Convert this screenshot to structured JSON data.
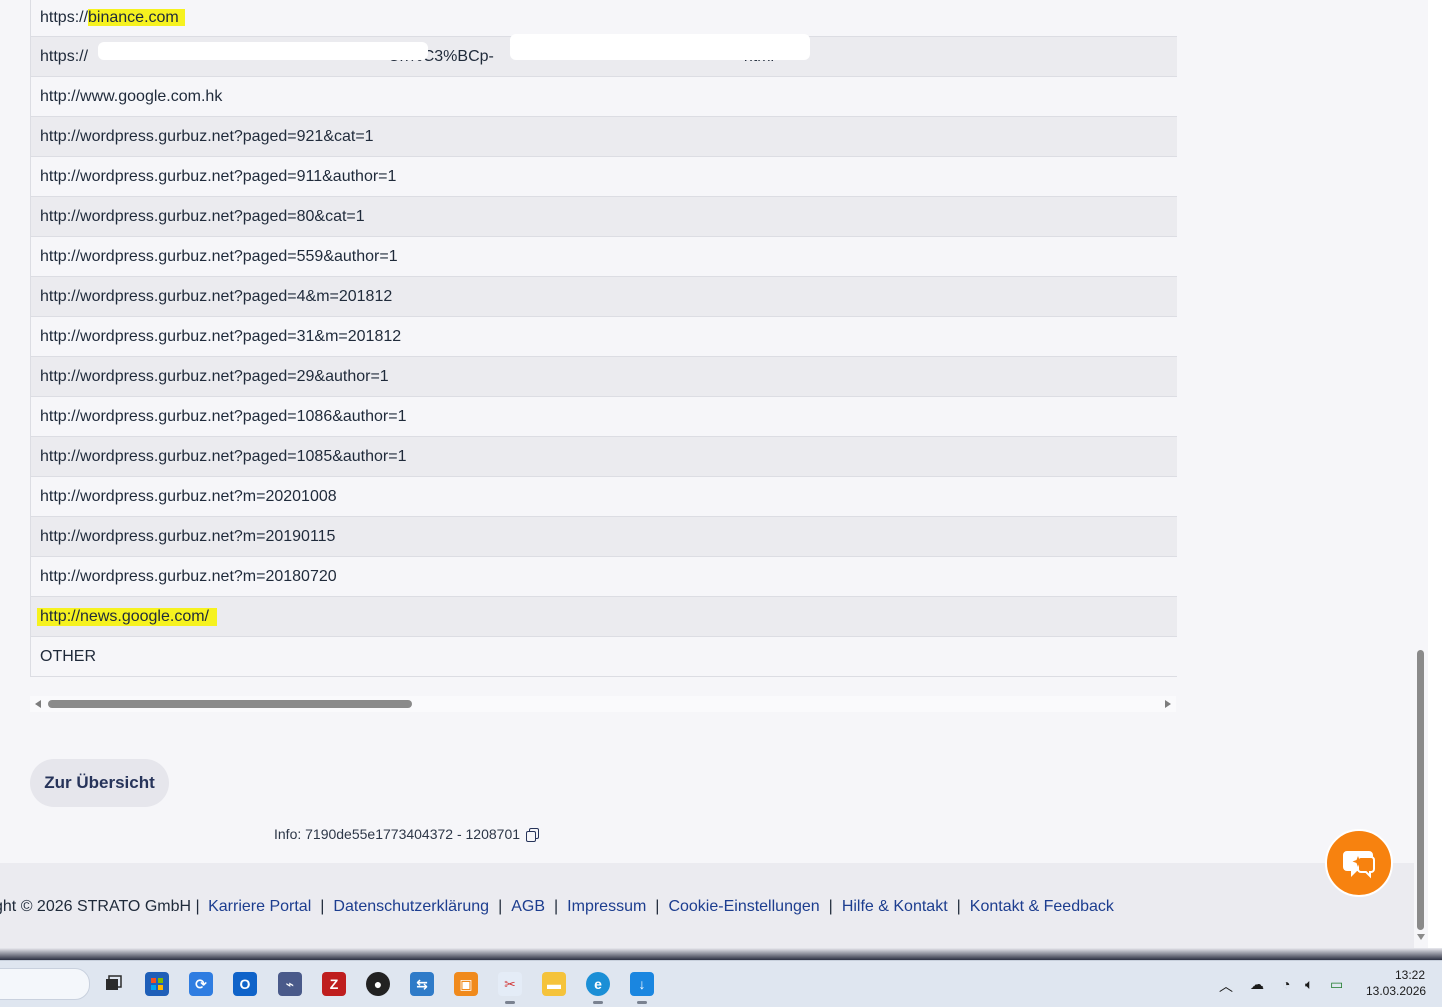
{
  "referrers": [
    {
      "url_prefix": "https://",
      "url_highlight": "binance.com",
      "url_suffix": "",
      "highlight": true
    },
    {
      "url_visible_start": "https://",
      "url_visible_mid": "Cn%C3%BCp-",
      "url_visible_end": "html",
      "redacted": true
    },
    {
      "url": "http://www.google.com.hk"
    },
    {
      "url": "http://wordpress.gurbuz.net?paged=921&cat=1"
    },
    {
      "url": "http://wordpress.gurbuz.net?paged=911&author=1"
    },
    {
      "url": "http://wordpress.gurbuz.net?paged=80&cat=1"
    },
    {
      "url": "http://wordpress.gurbuz.net?paged=559&author=1"
    },
    {
      "url": "http://wordpress.gurbuz.net?paged=4&m=201812"
    },
    {
      "url": "http://wordpress.gurbuz.net?paged=31&m=201812"
    },
    {
      "url": "http://wordpress.gurbuz.net?paged=29&author=1"
    },
    {
      "url": "http://wordpress.gurbuz.net?paged=1086&author=1"
    },
    {
      "url": "http://wordpress.gurbuz.net?paged=1085&author=1"
    },
    {
      "url": "http://wordpress.gurbuz.net?m=20201008"
    },
    {
      "url": "http://wordpress.gurbuz.net?m=20190115"
    },
    {
      "url": "http://wordpress.gurbuz.net?m=20180720"
    },
    {
      "url": "http://news.google.com/",
      "highlight": true
    },
    {
      "url": "OTHER"
    }
  ],
  "actions": {
    "overview_label": "Zur Übersicht"
  },
  "info": {
    "text": "Info: 7190de55e1773404372 - 1208701"
  },
  "footer": {
    "copyright": "ght © 2026 STRATO GmbH |",
    "links": [
      "Karriere Portal",
      "Datenschutzerklärung",
      "AGB",
      "Impressum",
      "Cookie-Einstellungen",
      "Hilfe & Kontakt",
      "Kontakt & Feedback"
    ],
    "separator": "|"
  },
  "taskbar": {
    "time": "13:22",
    "date": "13.03.2026"
  },
  "colors": {
    "highlight": "#f6f21f",
    "accent_chat": "#f7820f",
    "link": "#1c3d8f"
  }
}
